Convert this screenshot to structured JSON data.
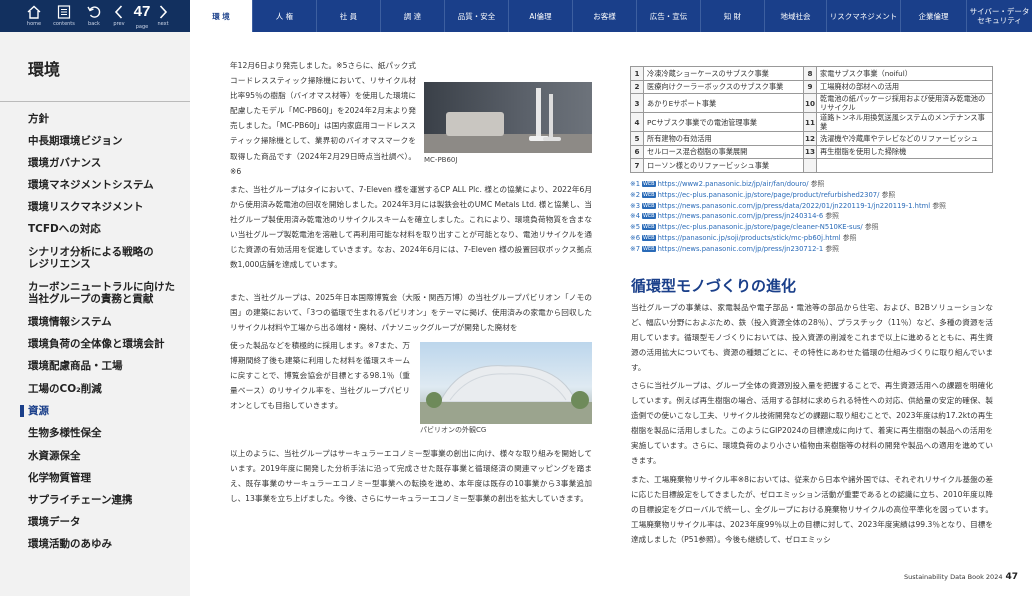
{
  "nav": {
    "tools": [
      {
        "name": "home",
        "label": "home"
      },
      {
        "name": "contents",
        "label": "contents"
      },
      {
        "name": "back",
        "label": "back"
      },
      {
        "name": "prev",
        "label": "prev"
      },
      {
        "name": "page",
        "label": "page"
      },
      {
        "name": "next",
        "label": "next"
      }
    ],
    "page_number": "47",
    "tabs": [
      "環 境",
      "人 権",
      "社 員",
      "調 達",
      "品質・安全",
      "AI倫理",
      "お客様",
      "広告・宣伝",
      "知 財",
      "地域社会",
      "リスクマネジメント",
      "企業倫理",
      "サイバー・データ\nセキュリティ"
    ]
  },
  "sidebar": {
    "title": "環境",
    "items": [
      "方針",
      "中長期環境ビジョン",
      "環境ガバナンス",
      "環境マネジメントシステム",
      "環境リスクマネジメント",
      "TCFDへの対応",
      "シナリオ分析による戦略の\nレジリエンス",
      "カーボンニュートラルに向けた\n当社グループの責務と貢献",
      "環境情報システム",
      "環境負荷の全体像と環境会計",
      "環境配慮商品・工場",
      "工場のCO₂削減",
      "資源",
      "生物多様性保全",
      "水資源保全",
      "化学物質管理",
      "サプライチェーン連携",
      "環境データ",
      "環境活動のあゆみ"
    ]
  },
  "main": {
    "para1": "年12月6日より発売しました。※5さらに、紙パック式コードレススティック掃除機において、リサイクル材比率95％の樹脂（バイオマス材等）を使用した環境に配慮したモデル「MC-PB60J」を2024年2月末より発売しました。「MC-PB60J」は国内家庭用コードレススティック掃除機として、業界初のバイオマスマークを取得した商品です（2024年2月29日時点当社調べ）。※6",
    "fig1_caption": "MC-PB60J",
    "para2": "また、当社グループはタイにおいて、7-Eleven 様を運営するCP ALL Plc. 様との協業により、2022年6月から使用済み乾電池の回収を開始しました。2024年3月には製鉄会社のUMC Metals Ltd. 様と協業し、当社グループ製使用済み乾電池のリサイクルスキームを確立しました。これにより、環境負荷物質を含まない当社グループ製乾電池を溶融して再利用可能な材料を取り出すことが可能となり、電池リサイクルを通じた資源の有効活用を促進していきます。なお、2024年6月には、7-Eleven 様の設置回収ボックス拠点数1,000店舗を達成しています。",
    "para3": "また、当社グループは、2025年日本国際博覧会（大阪・関西万博）の当社グループパビリオン「ノモの国」の建築において、「3つの循環で生まれるパビリオン」をテーマに掲げ、使用済みの家電から回収したリサイクル材料や工場から出る端材・廃材、パナソニックグループが開発した廃材を使った製品などを積極的に採用します。※7また、万博期間終了後も建築に利用した材料を循環スキームに戻すことで、博覧会協会が目標とする98.1％（重量ベース）のリサイクル率を、当社グループパビリオンとしても目指していきます。",
    "fig2_caption": "パビリオンの外観CG",
    "para4": "以上のように、当社グループはサーキュラーエコノミー型事業の創出に向け、様々な取り組みを開始しています。2019年度に開発した分析手法に沿って完成させた既存事業と循環経済の関連マッピングを踏まえ、既存事業のサーキュラーエコノミー型事業への転換を進め、本年度は既存の10事業から3事業追加し、13事業を立ち上げました。今後、さらにサーキュラーエコノミー型事業の創出を拡大していきます。",
    "table_left": [
      {
        "no": "1",
        "text": "冷凍冷蔵ショーケースのサブスク事業"
      },
      {
        "no": "2",
        "text": "医療向けクーラーボックスのサブスク事業"
      },
      {
        "no": "3",
        "text": "あかりEサポート事業"
      },
      {
        "no": "4",
        "text": "PCサブスク事業での電池管理事業"
      },
      {
        "no": "5",
        "text": "所有建物の有効活用"
      },
      {
        "no": "6",
        "text": "セルロース混合樹脂の事業展開"
      },
      {
        "no": "7",
        "text": "ローソン様とのリファービッシュ事業"
      }
    ],
    "table_right": [
      {
        "no": "8",
        "text": "家電サブスク事業（noiful）"
      },
      {
        "no": "9",
        "text": "工場廃材の部材への活用"
      },
      {
        "no": "10",
        "text": "乾電池の紙パッケージ採用および使用済み乾電池のリサイクル"
      },
      {
        "no": "11",
        "text": "道路トンネル用換気送風システムのメンテナンス事業"
      },
      {
        "no": "12",
        "text": "洗濯機や冷蔵庫やテレビなどのリファービッシュ"
      },
      {
        "no": "13",
        "text": "再生樹脂を使用した掃除機"
      }
    ],
    "footnotes": [
      {
        "mark": "※1",
        "url": "https://www2.panasonic.biz/jp/air/fan/douro/",
        "ref": "参照"
      },
      {
        "mark": "※2",
        "url": "https://ec-plus.panasonic.jp/store/page/product/refurbished2307/",
        "ref": "参照"
      },
      {
        "mark": "※3",
        "url": "https://news.panasonic.com/jp/press/data/2022/01/jn220119-1/jn220119-1.html",
        "ref": "参照"
      },
      {
        "mark": "※4",
        "url": "https://news.panasonic.com/jp/press/jn240314-6",
        "ref": "参照"
      },
      {
        "mark": "※5",
        "url": "https://ec-plus.panasonic.jp/store/page/cleaner-N510KE-sus/",
        "ref": "参照"
      },
      {
        "mark": "※6",
        "url": "https://panasonic.jp/soji/products/stick/mc-pb60j.html",
        "ref": "参照"
      },
      {
        "mark": "※7",
        "url": "https://news.panasonic.com/jp/press/jn230712-1",
        "ref": "参照"
      }
    ],
    "section_title": "循環型モノづくりの進化",
    "para5": "当社グループの事業は、家電製品や電子部品・電池等の部品から住宅、および、B2Bソリューションなど、幅広い分野におよぶため、鉄（投入資源全体の28％）、プラスチック（11％）など、多種の資源を活用しています。循環型モノづくりにおいては、投入資源の削減をこれまで以上に進めるとともに、再生資源の活用拡大についても、資源の種類ごとに、その特性にあわせた循環の仕組みづくりに取り組んでいます。",
    "para6": "さらに当社グループは、グループ全体の資源別投入量を把握することで、再生資源活用への課題を明確化しています。例えば再生樹脂の場合、活用する部材に求められる特性への対応、供給量の安定的確保、製造側での使いこなし工夫、リサイクル技術開発などの課題に取り組むことで、2023年度は約17.2ktの再生樹脂を製品に活用しました。このようにGIP2024の目標達成に向けて、着実に再生樹脂の製品への活用を実施しています。さらに、環境負荷のより小さい植物由来樹脂等の材料の開発や製品への適用を進めていきます。",
    "para7": "また、工場廃棄物リサイクル率※8においては、従来から日本や諸外国では、それぞれリサイクル基盤の差に応じた目標設定をしてきましたが、ゼロエミッション活動が重要であるとの認識に立ち、2010年度以降の目標設定をグローバルで統一し、全グループにおける廃棄物リサイクルの高位平準化を図っています。工場廃棄物リサイクル率は、2023年度99％以上の目標に対して、2023年度実績は99.3％となり、目標を達成しました（P51参照）。今後も継続して、ゼロエミッシ"
  },
  "footer": {
    "doc_title": "Sustainability Data Book 2024",
    "page": "47"
  }
}
